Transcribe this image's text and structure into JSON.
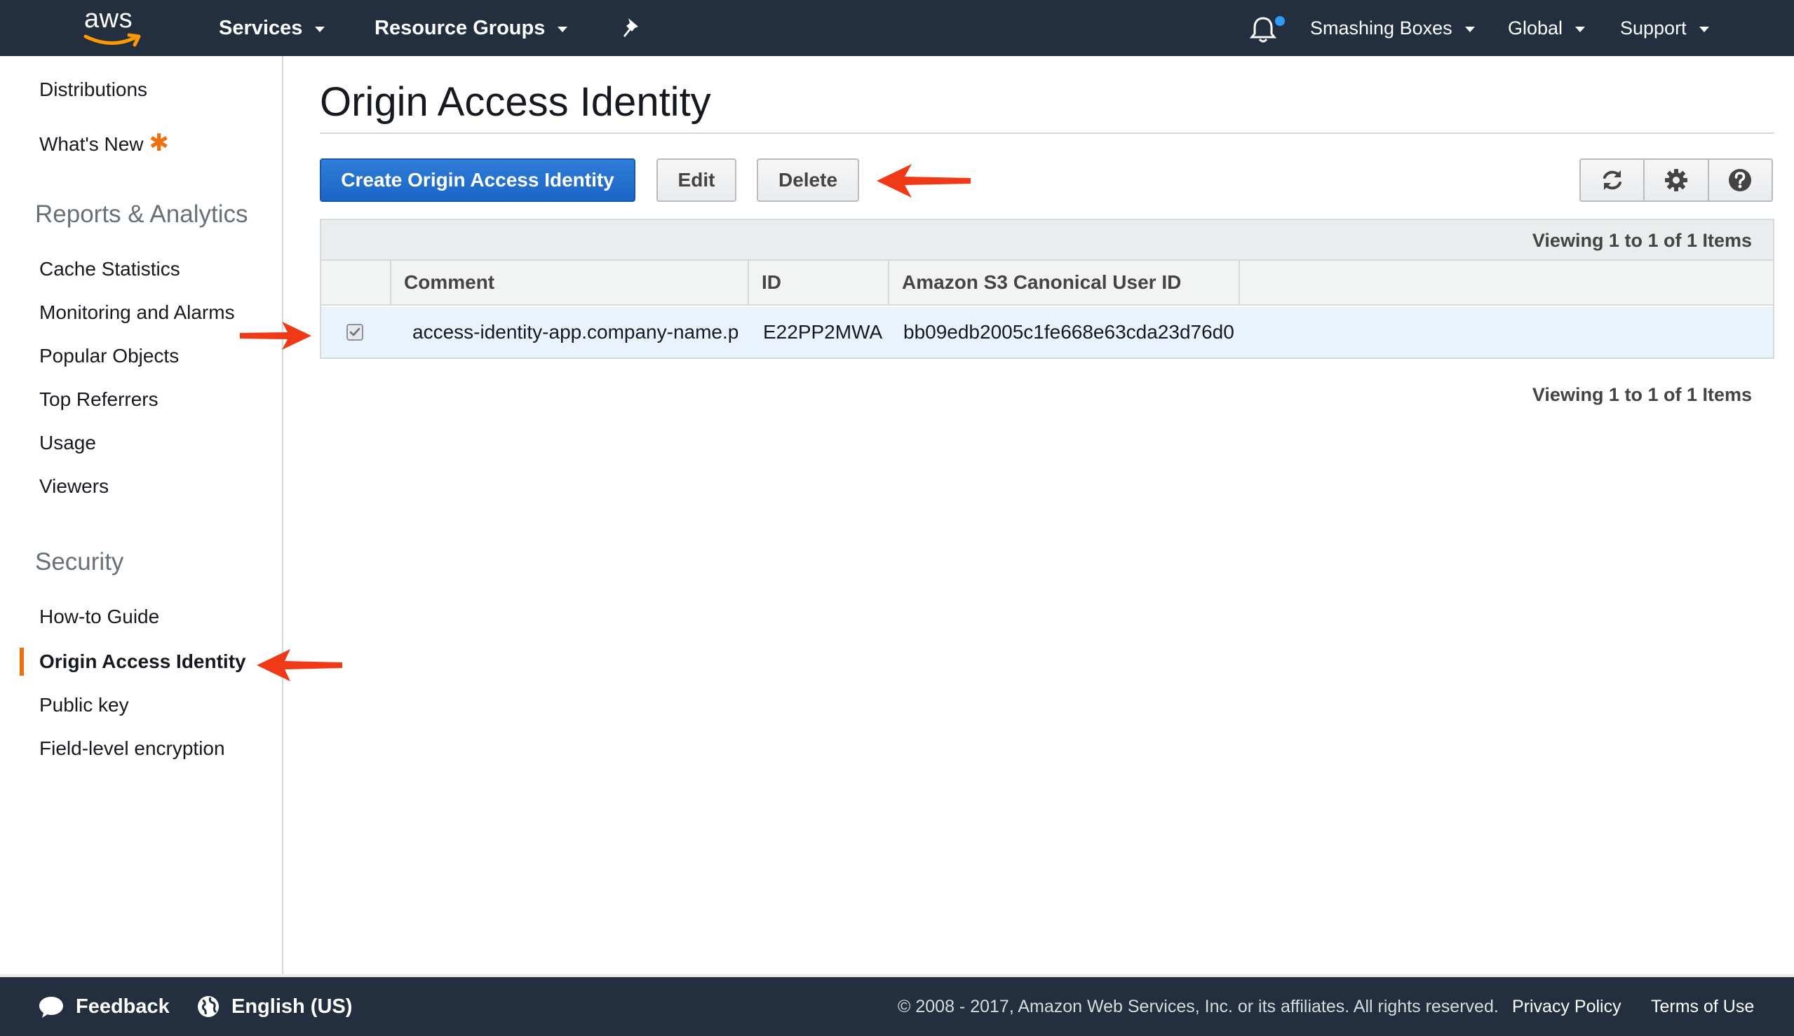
{
  "topnav": {
    "logo_text": "aws",
    "services_label": "Services",
    "resource_groups_label": "Resource Groups",
    "account_label": "Smashing Boxes",
    "region_label": "Global",
    "support_label": "Support"
  },
  "sidebar": {
    "links_top": [
      {
        "label": "Distributions"
      },
      {
        "label": "What's New"
      }
    ],
    "whats_new_marker": "✱",
    "reports_heading": "Reports & Analytics",
    "reports_items": [
      {
        "label": "Cache Statistics"
      },
      {
        "label": "Monitoring and Alarms"
      },
      {
        "label": "Popular Objects"
      },
      {
        "label": "Top Referrers"
      },
      {
        "label": "Usage"
      },
      {
        "label": "Viewers"
      }
    ],
    "security_heading": "Security",
    "security_items": [
      {
        "label": "How-to Guide"
      },
      {
        "label": "Origin Access Identity",
        "active": true
      },
      {
        "label": "Public key"
      },
      {
        "label": "Field-level encryption"
      }
    ]
  },
  "main": {
    "title": "Origin Access Identity",
    "create_button": "Create Origin Access Identity",
    "edit_button": "Edit",
    "delete_button": "Delete",
    "toolbar_icons": [
      "refresh-icon",
      "gear-icon",
      "help-icon"
    ],
    "viewing_top": "Viewing 1 to 1 of 1 Items",
    "viewing_bottom": "Viewing 1 to 1 of 1 Items",
    "table": {
      "columns": [
        "Comment",
        "ID",
        "Amazon S3 Canonical User ID"
      ],
      "rows": [
        {
          "checked": true,
          "comment": "access-identity-app.company-name.p",
          "id": "E22PP2MWA",
          "canonical_user_id": "bb09edb2005c1fe668e63cda23d76d0"
        }
      ]
    }
  },
  "footer": {
    "feedback_label": "Feedback",
    "language_label": "English (US)",
    "copyright": "© 2008 - 2017, Amazon Web Services, Inc. or its affiliates. All rights reserved.",
    "privacy_label": "Privacy Policy",
    "terms_label": "Terms of Use"
  },
  "colors": {
    "nav_bg": "#232f3e",
    "primary_button": "#1b65c4",
    "active_accent": "#ec7211",
    "annotation_arrow": "#f03a17",
    "selected_row": "#eaf3fd"
  }
}
